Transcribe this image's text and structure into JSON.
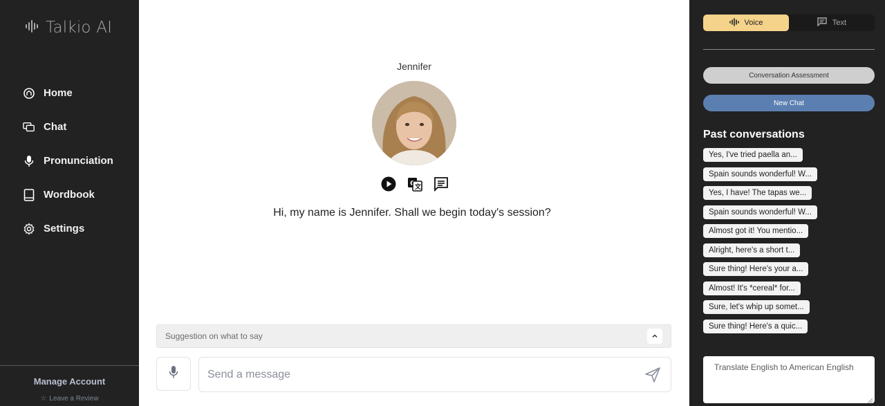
{
  "app": {
    "name": "Talkio AI"
  },
  "sidebar": {
    "items": [
      {
        "label": "Home",
        "icon": "home-icon"
      },
      {
        "label": "Chat",
        "icon": "chat-icon"
      },
      {
        "label": "Pronunciation",
        "icon": "microphone-icon"
      },
      {
        "label": "Wordbook",
        "icon": "book-icon"
      },
      {
        "label": "Settings",
        "icon": "gear-icon"
      }
    ],
    "manage_account": "Manage Account",
    "leave_review": "Leave a Review"
  },
  "main": {
    "agent_name": "Jennifer",
    "greeting": "Hi, my name is Jennifer. Shall we begin today's session?",
    "suggestion_label": "Suggestion on what to say",
    "message_placeholder": "Send a message"
  },
  "right_panel": {
    "mode": {
      "voice_label": "Voice",
      "text_label": "Text",
      "selected": "Voice"
    },
    "assessment_button": "Conversation Assessment",
    "new_chat_button": "New Chat",
    "past_title": "Past conversations",
    "past_conversations": [
      "Yes, I've tried paella an...",
      "Spain sounds wonderful! W...",
      "Yes, I have! The tapas we...",
      "Spain sounds wonderful! W...",
      "Almost got it! You mentio...",
      "Alright, here's a short t...",
      "Sure thing! Here's your a...",
      "Almost! It's *cereal* for...",
      "Sure, let's whip up somet...",
      "Sure thing! Here's a quic..."
    ],
    "translate_value": "Translate English to American English"
  },
  "colors": {
    "sidebar_bg": "#222222",
    "voice_accent": "#f5d38a",
    "new_chat": "#5b7fb0",
    "assessment": "#cfcfcf"
  }
}
